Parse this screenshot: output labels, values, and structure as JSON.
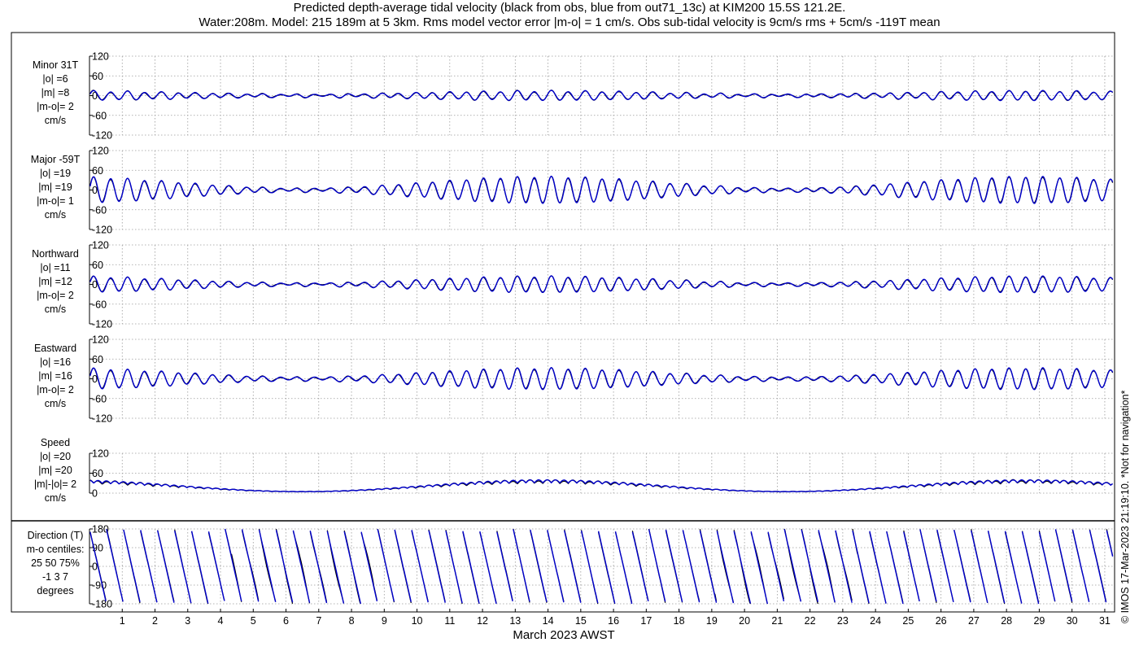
{
  "title_line1": "Predicted depth-average tidal velocity (black from obs, blue from out71_13c) at KIM200 15.5S 121.2E.",
  "title_line2": "Water:208m. Model: 215 189m at 5 3km. Rms model vector error |m-o| = 1 cm/s. Obs sub-tidal velocity is 9cm/s rms + 5cm/s -119T mean",
  "copyright": "© IMOS 17-Mar-2023 21:19:10. *Not for navigation*",
  "colors": {
    "obs": "#000000",
    "model": "#0000cc",
    "grid": "#9a9a9a"
  },
  "chart_data": [
    {
      "type": "line",
      "panel": "minor",
      "labels": [
        "Minor 31T",
        "|o| =6",
        "|m| =8",
        "|m-o|= 2",
        "cm/s"
      ],
      "ylim": [
        -120,
        120
      ],
      "yticks": [
        120,
        60,
        0,
        -60,
        -120
      ],
      "amplitude_range": [
        4,
        14
      ],
      "grid": true,
      "series": [
        {
          "name": "obs"
        },
        {
          "name": "model"
        }
      ]
    },
    {
      "type": "line",
      "panel": "major",
      "labels": [
        "Major -59T",
        "|o| =19",
        "|m| =19",
        "|m-o|= 1",
        "cm/s"
      ],
      "ylim": [
        -120,
        120
      ],
      "yticks": [
        120,
        60,
        0,
        -60,
        -120
      ],
      "amplitude_range": [
        5,
        40
      ],
      "grid": true,
      "series": [
        {
          "name": "obs"
        },
        {
          "name": "model"
        }
      ]
    },
    {
      "type": "line",
      "panel": "northward",
      "labels": [
        "Northward",
        "|o| =11",
        "|m| =12",
        "|m-o|= 2",
        "cm/s"
      ],
      "ylim": [
        -120,
        120
      ],
      "yticks": [
        120,
        60,
        0,
        -60,
        -120
      ],
      "amplitude_range": [
        4,
        24
      ],
      "grid": true,
      "series": [
        {
          "name": "obs"
        },
        {
          "name": "model"
        }
      ]
    },
    {
      "type": "line",
      "panel": "eastward",
      "labels": [
        "Eastward",
        "|o| =16",
        "|m| =16",
        "|m-o|= 2",
        "cm/s"
      ],
      "ylim": [
        -120,
        120
      ],
      "yticks": [
        120,
        60,
        0,
        -60,
        -120
      ],
      "amplitude_range": [
        5,
        32
      ],
      "grid": true,
      "series": [
        {
          "name": "obs"
        },
        {
          "name": "model"
        }
      ]
    },
    {
      "type": "line",
      "panel": "speed",
      "labels": [
        "Speed",
        "|o| =20",
        "|m| =20",
        "|m|-|o|= 2",
        "cm/s"
      ],
      "ylim": [
        0,
        120
      ],
      "yticks": [
        120,
        60,
        0
      ],
      "speed_range": [
        5,
        40
      ],
      "grid": true,
      "series": [
        {
          "name": "obs"
        },
        {
          "name": "model"
        }
      ]
    },
    {
      "type": "line",
      "panel": "direction",
      "labels": [
        "Direction (T)",
        "m-o centiles:",
        "25  50  75%",
        "-1  3  7",
        "degrees"
      ],
      "ylim": [
        -180,
        180
      ],
      "yticks": [
        180,
        90,
        0,
        -90,
        -180
      ],
      "grid": true,
      "series": [
        {
          "name": "obs"
        },
        {
          "name": "model"
        }
      ]
    }
  ],
  "x_axis": {
    "label": "March 2023 AWST",
    "xlim": [
      0,
      31.3
    ],
    "ticks": [
      1,
      2,
      3,
      4,
      5,
      6,
      7,
      8,
      9,
      10,
      11,
      12,
      13,
      14,
      15,
      16,
      17,
      18,
      19,
      20,
      21,
      22,
      23,
      24,
      25,
      26,
      27,
      28,
      29,
      30,
      31
    ],
    "tick_labels": [
      "1",
      "2",
      "3",
      "4",
      "5",
      "6",
      "7",
      "8",
      "9",
      "10",
      "11",
      "12",
      "13",
      "14",
      "15",
      "16",
      "17",
      "18",
      "19",
      "20",
      "21",
      "22",
      "23",
      "24",
      "25",
      "26",
      "27",
      "28",
      "29",
      "30",
      "31"
    ]
  }
}
